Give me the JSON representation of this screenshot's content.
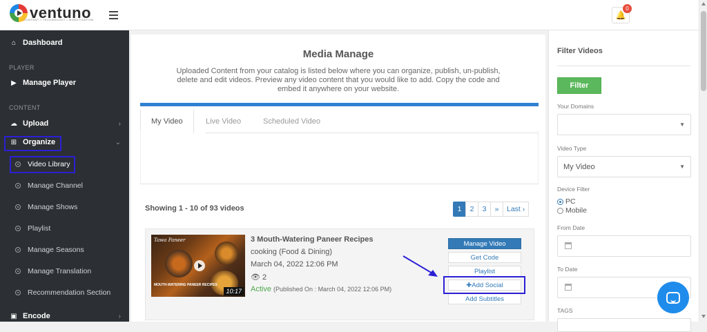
{
  "header": {
    "logo_text": "ventuno",
    "logo_tagline": "CONTENT • TECHNOLOGY • MONETIZATION",
    "notification_count": "0"
  },
  "sidebar": {
    "dashboard": "Dashboard",
    "section_player": "PLAYER",
    "manage_player": "Manage Player",
    "section_content": "CONTENT",
    "upload": "Upload",
    "organize": "Organize",
    "sub_items": [
      "Video Library",
      "Manage Channel",
      "Manage Shows",
      "Playlist",
      "Manage Seasons",
      "Manage Translation",
      "Recommendation Section"
    ],
    "encode": "Encode"
  },
  "main": {
    "title": "Media Manage",
    "description": "Uploaded Content from your catalog is listed below where you can organize, publish, un-publish, delete and edit videos. Preview any video content that you would like to add. Copy the code and embed it anywhere on your website.",
    "tabs": [
      "My Video",
      "Live Video",
      "Scheduled Video"
    ],
    "showing": "Showing 1 - 10 of 93 videos",
    "pager": [
      "1",
      "2",
      "3",
      "»",
      "Last ›"
    ]
  },
  "video": {
    "thumb_title": "Tawa Paneer",
    "thumb_caption": "MOUTH-WATERING PANEER RECIPES",
    "duration": "10:17",
    "title": "3 Mouth-Watering Paneer Recipes",
    "category": "cooking (Food & Dining)",
    "date": "March 04, 2022 12:06 PM",
    "views": "2",
    "status": "Active",
    "published": "(Published On : March 04, 2022 12:06 PM)",
    "buttons": [
      "Manage Video",
      "Get Code",
      "Playlist",
      "Add Social",
      "Add Subtitles"
    ]
  },
  "filter": {
    "title": "Filter Videos",
    "filter_button": "Filter",
    "domains_label": "Your Domains",
    "domains_value": "",
    "video_type_label": "Video Type",
    "video_type_value": "My Video",
    "device_label": "Device Filter",
    "device_options": [
      "PC",
      "Mobile"
    ],
    "from_label": "From Date",
    "to_label": "To Date",
    "tags_label": "TAGS"
  },
  "colors": {
    "highlight": "#2b1fd6",
    "primary": "#337ab7",
    "success": "#5cb85c",
    "sidebar_bg": "#2c3034"
  }
}
